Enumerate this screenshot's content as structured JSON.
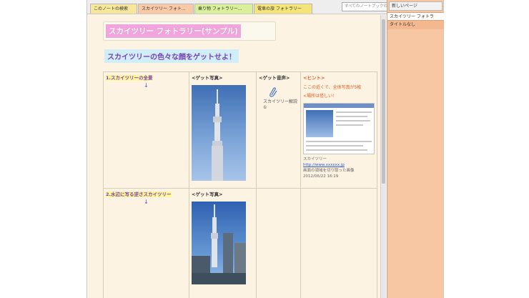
{
  "tabs": [
    {
      "label": "このノートの検索"
    },
    {
      "label": "スカイツリー フォト..."
    },
    {
      "label": "乗り物 フォトラリー..."
    },
    {
      "label": "電車の旅 フォトラリー"
    }
  ],
  "search": {
    "placeholder": "すべてのノートブックの検索 (Ctrl+E)"
  },
  "page": {
    "title": "スカイツリー フォトラリー(サンプル)",
    "subtitle": "スカイツリーの色々な顔をゲットせよ！"
  },
  "grid": {
    "row1": {
      "task": "1.スカイツリーの全景",
      "arrow": "↓",
      "photo_head": "<ゲット写真>",
      "voice_head": "<ゲット音声>",
      "voice_label": "スカイツリー解説①",
      "hint_head": "<ヒント>",
      "hint_line1": "ここの近くで、全体写真が5枚",
      "hint_line2": "<場所は怪しい!",
      "clip_title": "スカイツリー",
      "clip_link": "http://www.xxxxxx.jp",
      "clip_source": "画面の領域を切り取った画像",
      "clip_date": "2012/06/22 16:19"
    },
    "row2": {
      "task": "2.水辺に写る逆さスカイツリー",
      "arrow": "↓",
      "photo_head": "<ゲット写真>"
    }
  },
  "panel": {
    "new_page": "新しいページ",
    "pages": [
      {
        "label": "スカイツリー フォトラ"
      },
      {
        "label": "タイトルなし"
      }
    ]
  },
  "icons": [
    "clip-attachment-icon"
  ],
  "colors": {
    "title_bg": "#f0a6dc",
    "subtitle_bg": "#cfeef8",
    "accent_purple": "#7a3fb5",
    "hint_orange": "#e05a1c",
    "panel_bg": "#f7c6a3"
  }
}
